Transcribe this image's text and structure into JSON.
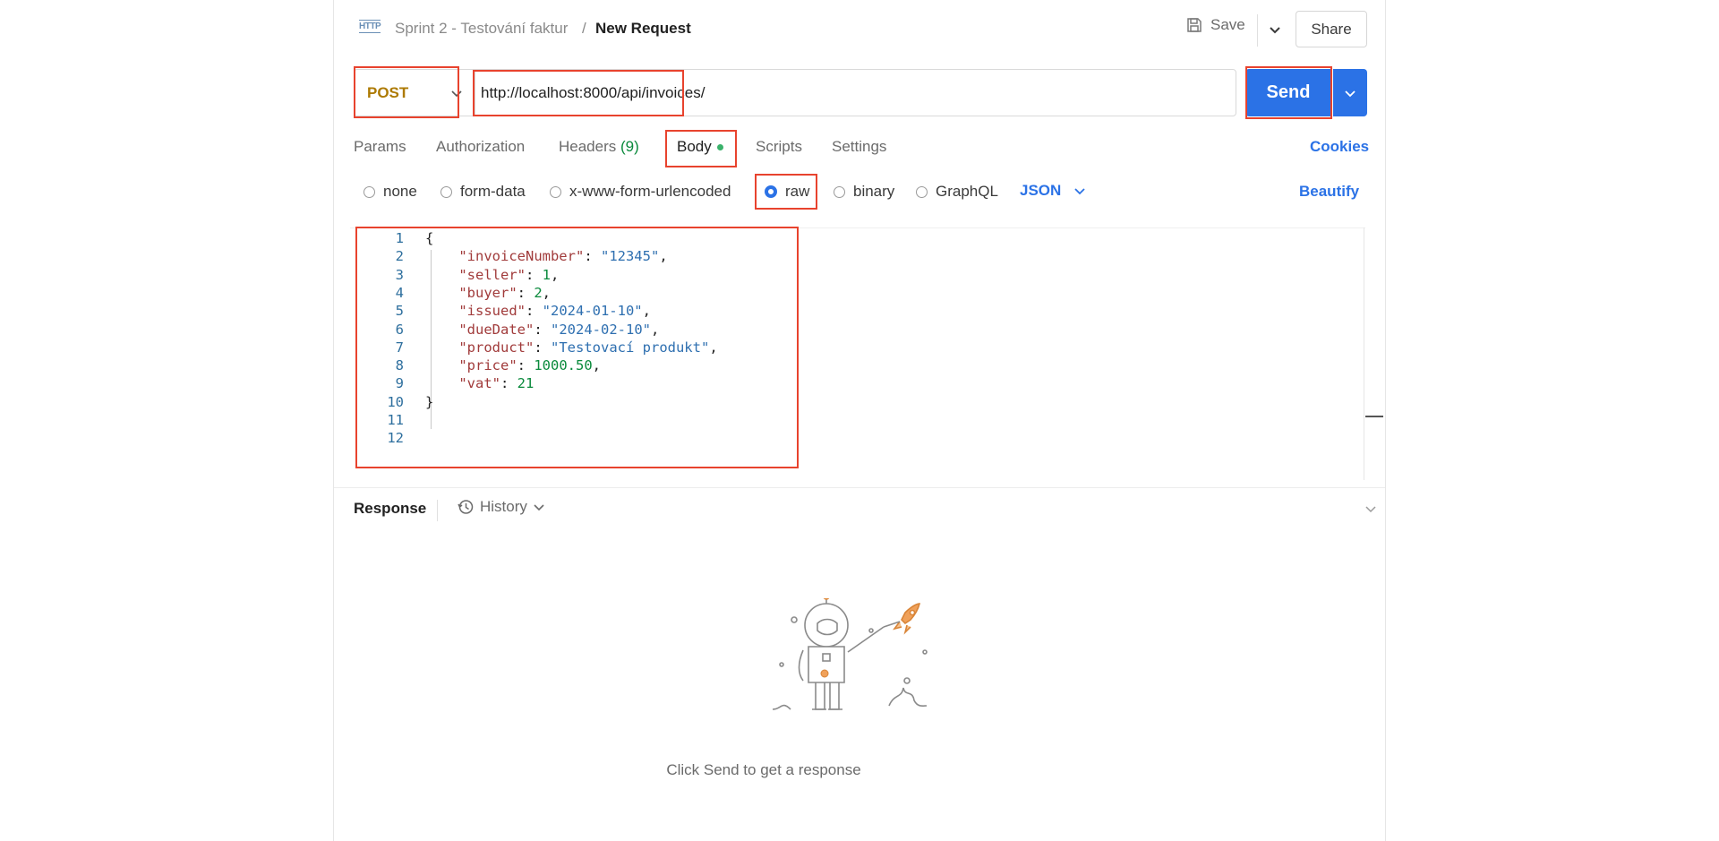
{
  "header": {
    "icon": "http-icon",
    "icon_label": "HTTP",
    "breadcrumb_parent": "Sprint 2 - Testování faktur",
    "breadcrumb_separator": "/",
    "breadcrumb_current": "New Request",
    "save_label": "Save",
    "share_label": "Share"
  },
  "request": {
    "method": "POST",
    "url": "http://localhost:8000/api/invoices/",
    "send_label": "Send"
  },
  "tabs": [
    {
      "label": "Params"
    },
    {
      "label": "Authorization"
    },
    {
      "label": "Headers",
      "count": "(9)"
    },
    {
      "label": "Body",
      "active": true
    },
    {
      "label": "Scripts"
    },
    {
      "label": "Settings"
    }
  ],
  "cookies_label": "Cookies",
  "body_types": [
    {
      "label": "none",
      "selected": false
    },
    {
      "label": "form-data",
      "selected": false
    },
    {
      "label": "x-www-form-urlencoded",
      "selected": false
    },
    {
      "label": "raw",
      "selected": true
    },
    {
      "label": "binary",
      "selected": false
    },
    {
      "label": "GraphQL",
      "selected": false
    }
  ],
  "format_label": "JSON",
  "beautify_label": "Beautify",
  "editor": {
    "line_numbers": [
      "1",
      "2",
      "3",
      "4",
      "5",
      "6",
      "7",
      "8",
      "9",
      "10",
      "11",
      "12"
    ],
    "lines": [
      {
        "open": "{"
      },
      {
        "key": "\"invoiceNumber\"",
        "value": "\"12345\"",
        "value_type": "string",
        "comma": ","
      },
      {
        "key": "\"seller\"",
        "value": "1",
        "value_type": "number",
        "comma": ","
      },
      {
        "key": "\"buyer\"",
        "value": "2",
        "value_type": "number",
        "comma": ","
      },
      {
        "key": "\"issued\"",
        "value": "\"2024-01-10\"",
        "value_type": "string",
        "comma": ","
      },
      {
        "key": "\"dueDate\"",
        "value": "\"2024-02-10\"",
        "value_type": "string",
        "comma": ","
      },
      {
        "key": "\"product\"",
        "value": "\"Testovací produkt\"",
        "value_type": "string",
        "comma": ","
      },
      {
        "key": "\"price\"",
        "value": "1000.50",
        "value_type": "number",
        "comma": ","
      },
      {
        "key": "\"vat\"",
        "value": "21",
        "value_type": "number",
        "comma": ""
      },
      {
        "open": "}"
      },
      {
        "open": ""
      },
      {
        "open": ""
      }
    ]
  },
  "response": {
    "label": "Response",
    "history_label": "History",
    "empty_message": "Click Send to get a response"
  },
  "colors": {
    "accent": "#2b72e6",
    "method": "#ad7a03",
    "highlight": "#e8432e"
  }
}
